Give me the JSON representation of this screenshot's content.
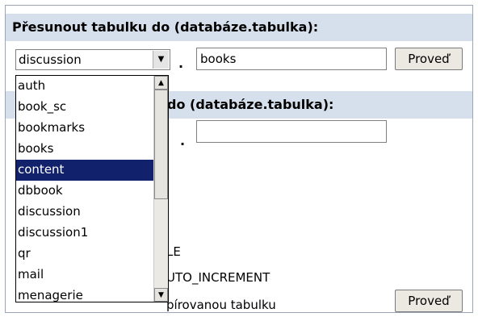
{
  "move": {
    "title": "Přesunout tabulku do (databáze.tabulka):",
    "db_value": "discussion",
    "dot": ".",
    "table_value": "books",
    "go_label": "Proveď"
  },
  "copy": {
    "title_visible": "do (databáze.tabulka):",
    "dot": ".",
    "table_value": ""
  },
  "options": {
    "line1": "LE",
    "line2": "UTO_INCREMENT",
    "line3": "pírovanou tabulku"
  },
  "copy_go_label": "Proveď",
  "dropdown": {
    "items": [
      "auth",
      "book_sc",
      "bookmarks",
      "books",
      "content",
      "dbbook",
      "discussion",
      "discussion1",
      "qr",
      "mail",
      "menagerie"
    ],
    "selected_index": 4
  },
  "colors": {
    "header_bg": "#d6dfec",
    "selection": "#11216c"
  }
}
